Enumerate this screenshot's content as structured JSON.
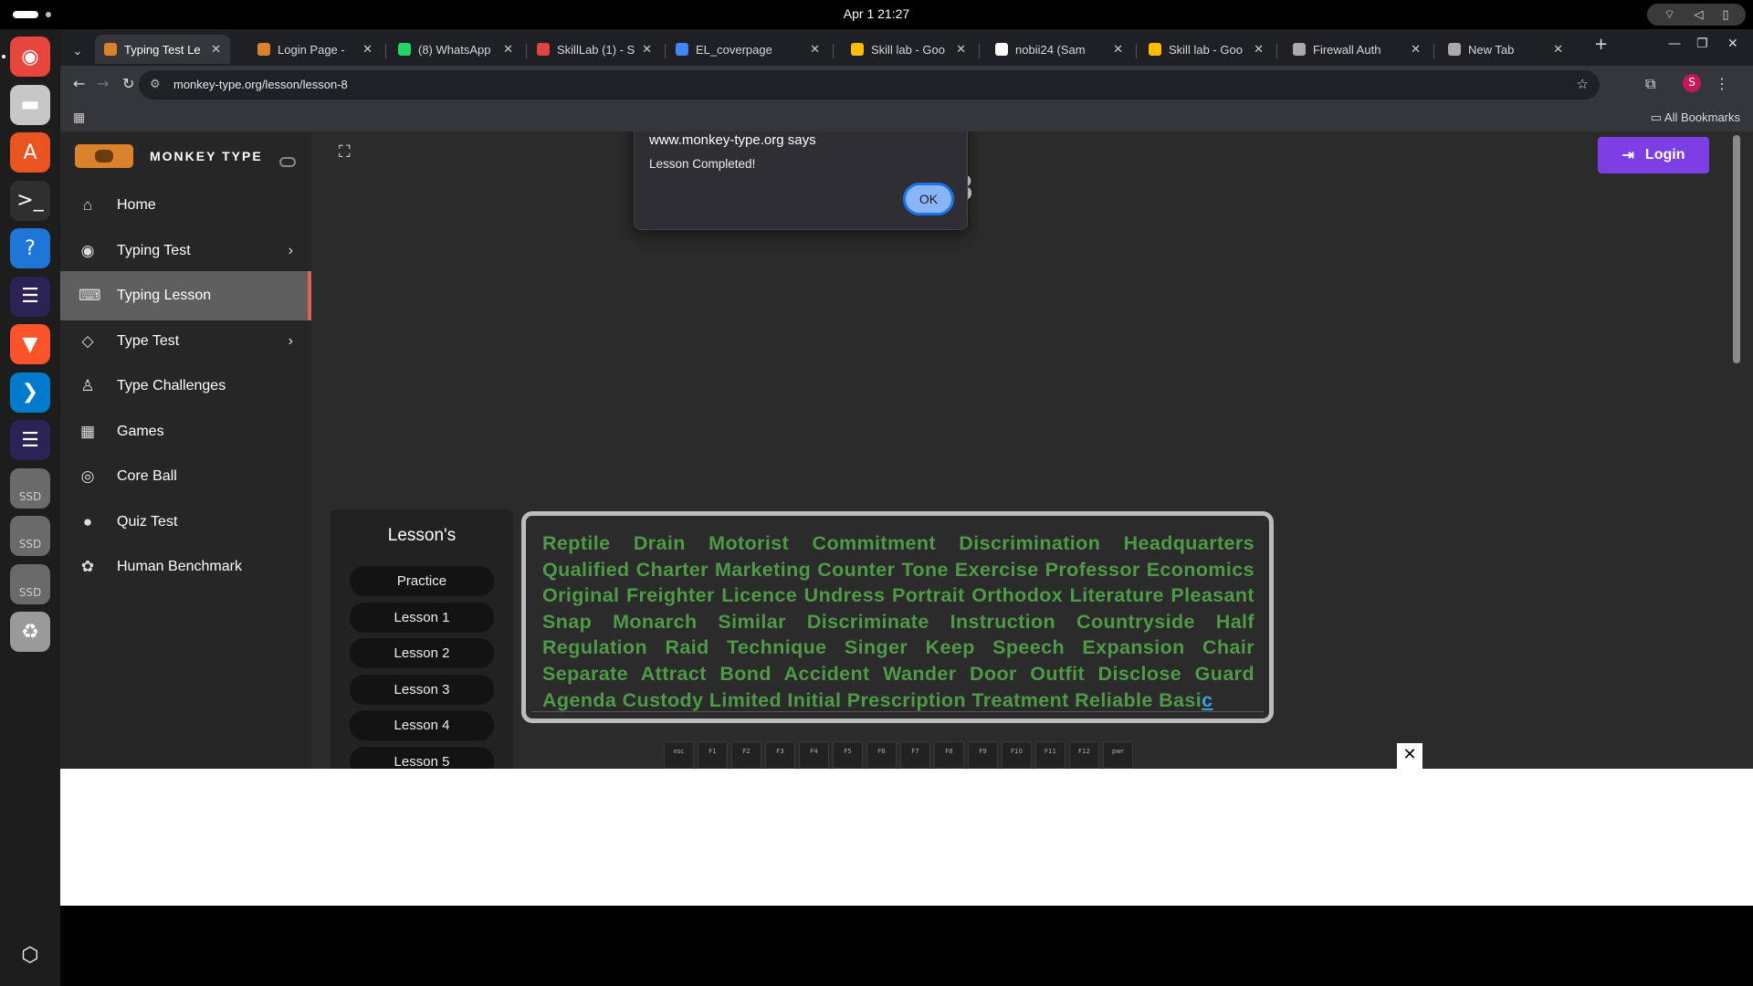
{
  "system": {
    "clock": "Apr 1  21:27",
    "tray_icons": [
      "network-icon",
      "volume-icon",
      "battery-icon"
    ]
  },
  "dock": {
    "items": [
      {
        "name": "chrome",
        "icon": "chrome-icon",
        "color": "#e8453c"
      },
      {
        "name": "files",
        "icon": "files-icon",
        "color": "#c7c7c7"
      },
      {
        "name": "app-center",
        "icon": "app-center-icon",
        "color": "#e95420"
      },
      {
        "name": "terminal",
        "icon": "terminal-icon",
        "color": "#2f2f2f"
      },
      {
        "name": "help",
        "icon": "help-icon",
        "color": "#1f76d6"
      },
      {
        "name": "eclipse",
        "icon": "eclipse-icon",
        "color": "#2c2255"
      },
      {
        "name": "brave",
        "icon": "brave-icon",
        "color": "#fb542b"
      },
      {
        "name": "vscode",
        "icon": "vscode-icon",
        "color": "#007acc"
      },
      {
        "name": "eclipse-2",
        "icon": "eclipse-icon",
        "color": "#2c2255"
      },
      {
        "name": "ssd-1",
        "icon": "drive-icon",
        "label": "SSD",
        "color": "#6a6a6a"
      },
      {
        "name": "ssd-2",
        "icon": "drive-icon",
        "label": "SSD",
        "color": "#6a6a6a"
      },
      {
        "name": "ssd-3",
        "icon": "drive-icon",
        "label": "SSD",
        "color": "#6a6a6a"
      },
      {
        "name": "trash",
        "icon": "trash-icon",
        "color": "#9a9a9a"
      },
      {
        "name": "show-apps",
        "icon": "ubuntu-grid-icon",
        "color": "#1d1d1d"
      }
    ]
  },
  "browser": {
    "tabs": [
      {
        "title": "Typing Test Le",
        "active": true,
        "favicon": "#d9822b"
      },
      {
        "title": "Login Page - ",
        "active": false,
        "favicon": "#d9822b"
      },
      {
        "title": "(8) WhatsApp",
        "active": false,
        "favicon": "#25d366"
      },
      {
        "title": "SkillLab (1) - S",
        "active": false,
        "favicon": "#e04444"
      },
      {
        "title": "EL_coverpage",
        "active": false,
        "favicon": "#4285f4"
      },
      {
        "title": "Skill lab - Goo",
        "active": false,
        "favicon": "#fbbc04"
      },
      {
        "title": "nobii24 (Sam",
        "active": false,
        "favicon": "#ffffff"
      },
      {
        "title": "Skill lab - Goo",
        "active": false,
        "favicon": "#fbbc04"
      },
      {
        "title": "Firewall Auth",
        "active": false,
        "favicon": "#aaaaaa"
      },
      {
        "title": "New Tab",
        "active": false,
        "favicon": "#aaaaaa"
      }
    ],
    "new_tab_label": "+",
    "url": "monkey-type.org/lesson/lesson-8",
    "all_bookmarks_label": "All Bookmarks",
    "profile_initial": "S"
  },
  "app": {
    "brand": "MONKEY TYPE",
    "nav": [
      {
        "label": "Home",
        "icon": "home-icon",
        "glyph": "⌂",
        "chevron": false,
        "active": false
      },
      {
        "label": "Typing Test",
        "icon": "github-icon",
        "glyph": "◉",
        "chevron": true,
        "active": false
      },
      {
        "label": "Typing Lesson",
        "icon": "keyboard-icon",
        "glyph": "⌨",
        "chevron": false,
        "active": true
      },
      {
        "label": "Type Test",
        "icon": "gitlab-icon",
        "glyph": "◇",
        "chevron": true,
        "active": false
      },
      {
        "label": "Type Challenges",
        "icon": "award-icon",
        "glyph": "♙",
        "chevron": false,
        "active": false
      },
      {
        "label": "Games",
        "icon": "grid-icon",
        "glyph": "▦",
        "chevron": false,
        "active": false
      },
      {
        "label": "Core Ball",
        "icon": "target-icon",
        "glyph": "◎",
        "chevron": false,
        "active": false
      },
      {
        "label": "Quiz Test",
        "icon": "quiz-avatar-icon",
        "glyph": "●",
        "chevron": false,
        "active": false
      },
      {
        "label": "Human Benchmark",
        "icon": "benchmark-icon",
        "glyph": "✿",
        "chevron": false,
        "active": false
      }
    ],
    "login_label": "Login",
    "lesson_title": "Lesson-8",
    "lessons_heading": "Lesson's",
    "lesson_buttons": [
      "Practice",
      "Lesson 1",
      "Lesson 2",
      "Lesson 3",
      "Lesson 4",
      "Lesson 5"
    ],
    "typing_text": "Reptile Drain Motorist Commitment Discrimination Headquarters Qualified Charter Marketing Counter Tone Exercise Professor Economics Original Freighter Licence Undress Portrait Orthodox Literature Pleasant Snap Monarch Similar Discriminate Instruction Countryside Half Regulation Raid Technique Singer Keep Speech Expansion Chair Separate Attract Bond Accident Wander Door Outfit Disclose Guard Agenda Custody Limited Initial Prescription Treatment Reliable Basi",
    "cursor_char": "c",
    "keys": [
      "esc",
      "F1",
      "F2",
      "F3",
      "F4",
      "F5",
      "F6",
      "F7",
      "F8",
      "F9",
      "F10",
      "F11",
      "F12",
      "pwr"
    ]
  },
  "dialog": {
    "title": "www.monkey-type.org says",
    "message": "Lesson Completed!",
    "ok_label": "OK"
  },
  "overlay": {
    "close_label": "✕"
  }
}
